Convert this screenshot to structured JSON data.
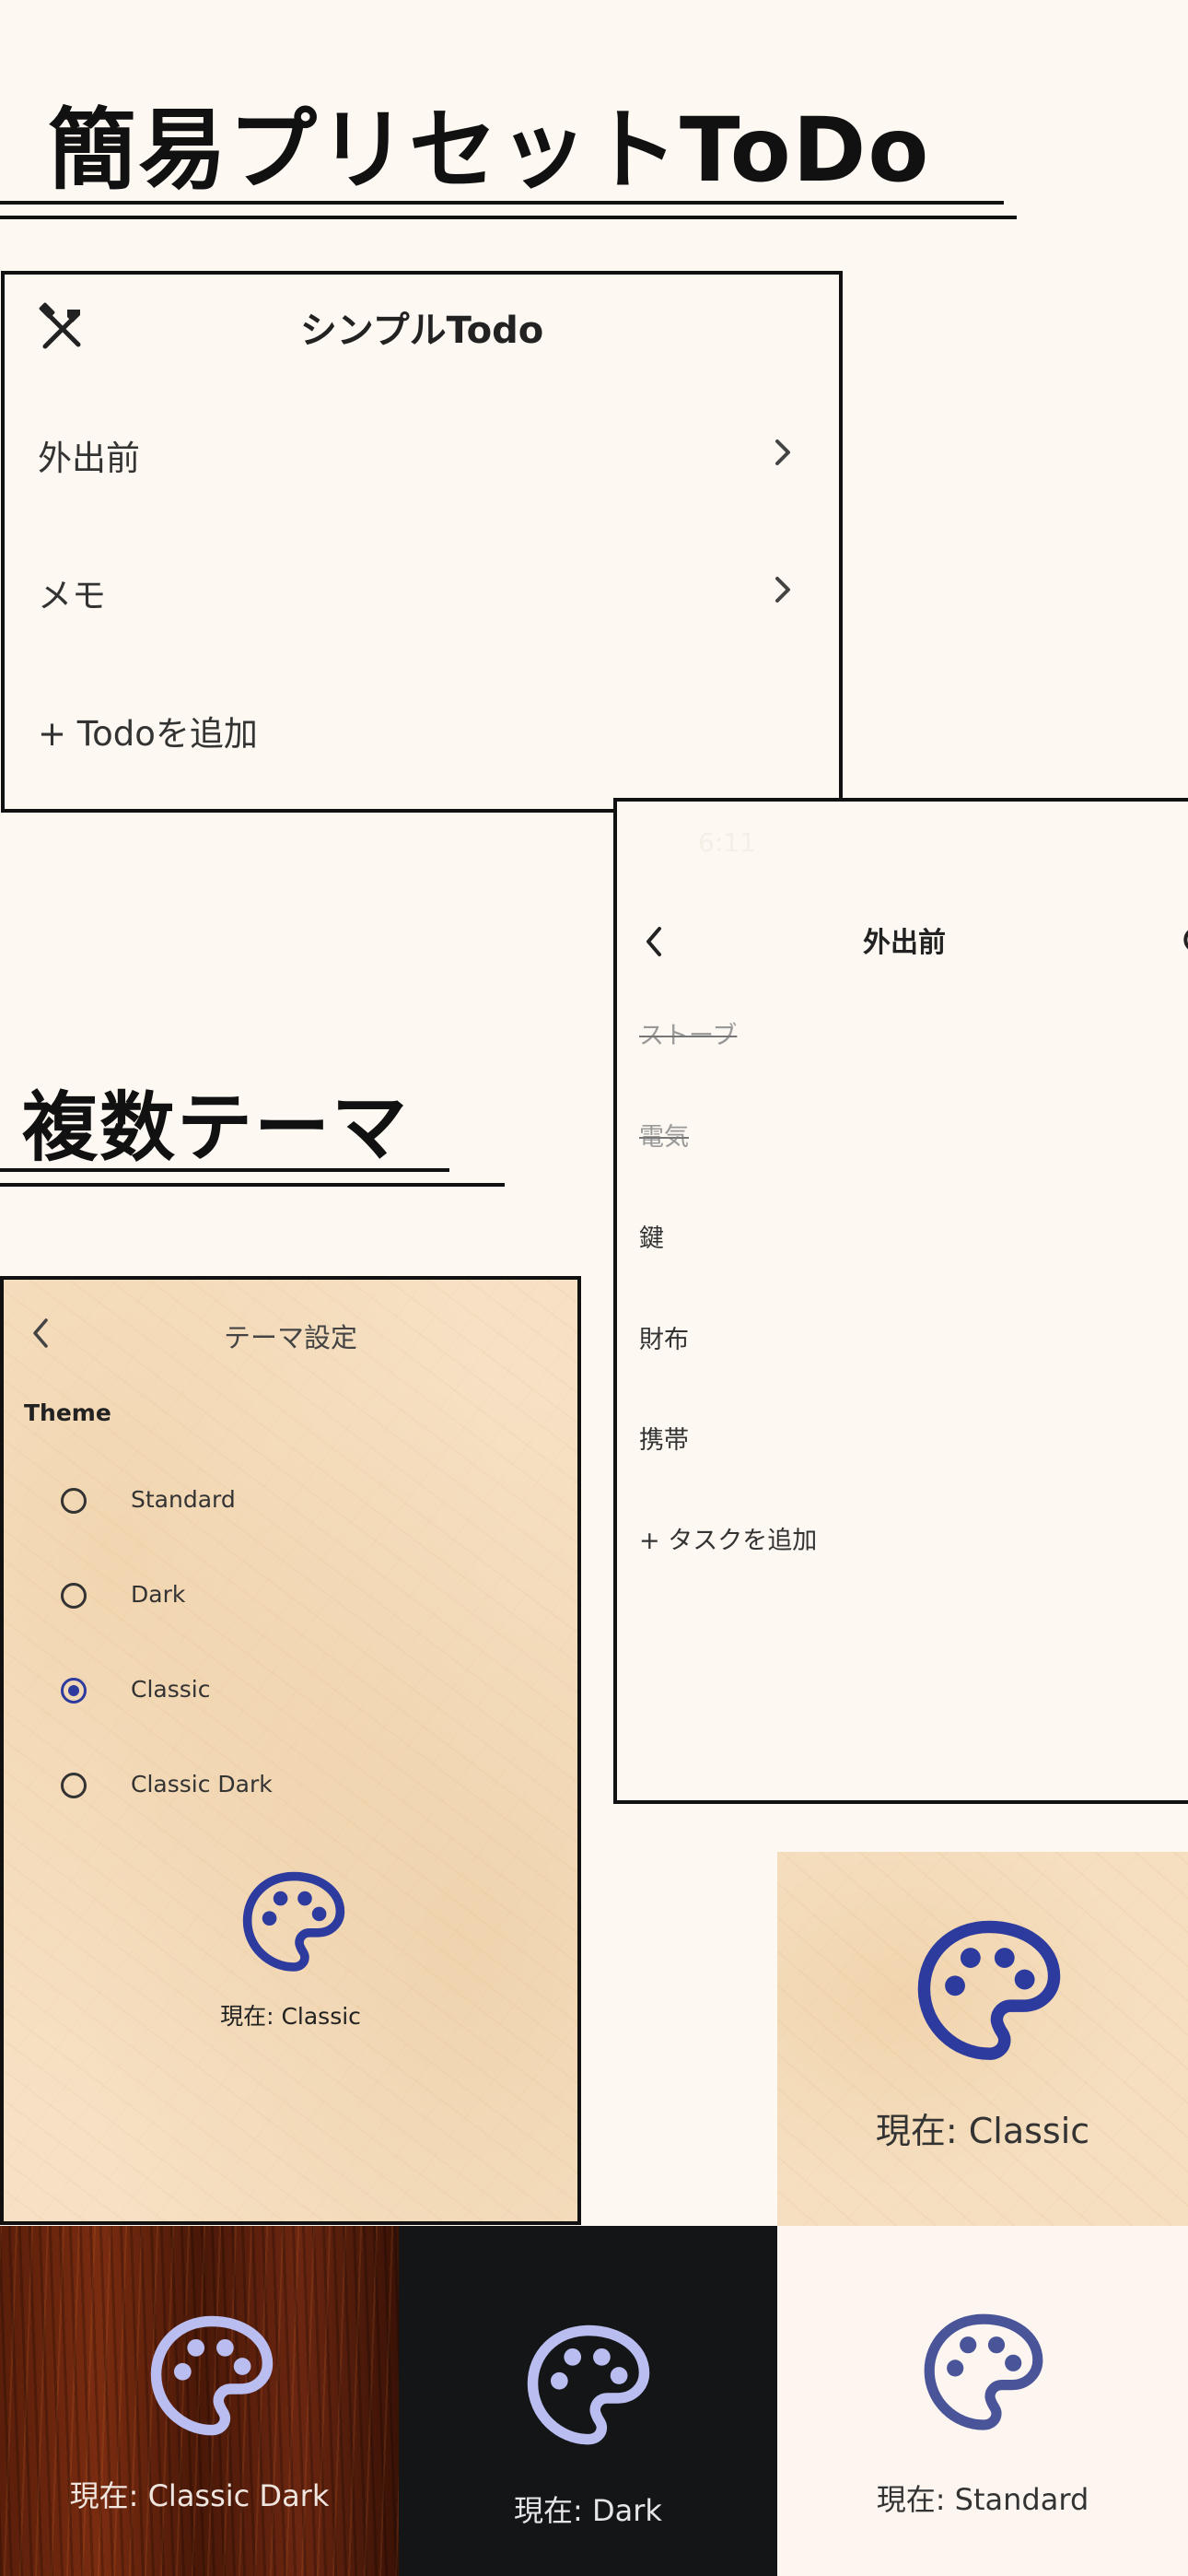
{
  "headings": {
    "feature1": "簡易プリセットToDo",
    "feature2": "複数テーマ"
  },
  "todo_list_screen": {
    "title": "シンプルTodo",
    "items": [
      {
        "label": "外出前"
      },
      {
        "label": "メモ"
      }
    ],
    "add_label": "+ Todoを追加"
  },
  "task_screen": {
    "status_time": "6:11",
    "title": "外出前",
    "tasks": [
      {
        "label": "ストーブ",
        "done": true
      },
      {
        "label": "電気",
        "done": true
      },
      {
        "label": "鍵",
        "done": false
      },
      {
        "label": "財布",
        "done": false
      },
      {
        "label": "携帯",
        "done": false
      }
    ],
    "add_label": "+ タスクを追加"
  },
  "theme_screen": {
    "title": "テーマ設定",
    "section_label": "Theme",
    "options": [
      {
        "label": "Standard",
        "selected": false
      },
      {
        "label": "Dark",
        "selected": false
      },
      {
        "label": "Classic",
        "selected": true
      },
      {
        "label": "Classic Dark",
        "selected": false
      }
    ],
    "current_label": "現在: Classic"
  },
  "theme_previews": {
    "classic": {
      "caption": "現在: Classic",
      "icon_color": "#2d3b9e"
    },
    "classic_dark": {
      "caption": "現在: Classic Dark",
      "icon_color": "#b9bdf0"
    },
    "dark": {
      "caption": "現在: Dark",
      "icon_color": "#b9bdf0"
    },
    "standard": {
      "caption": "現在: Standard",
      "icon_color": "#4a5499"
    }
  },
  "colors": {
    "accent": "#2d3b9e",
    "page_bg": "#fdf8f2"
  }
}
